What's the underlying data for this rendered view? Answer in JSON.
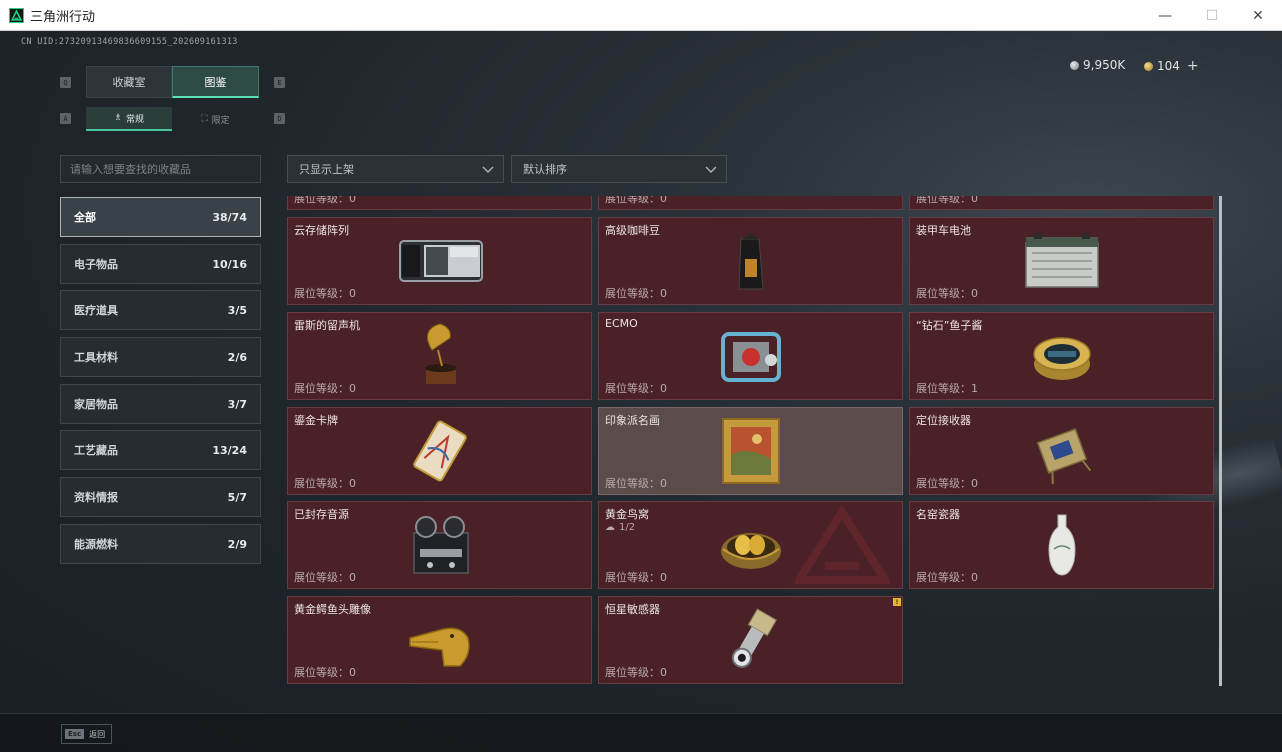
{
  "window": {
    "title": "三角洲行动",
    "minimize": "—",
    "maximize": "☐",
    "close": "✕"
  },
  "header": {
    "uid": "CN UID:2732091346983660915​5_202609161313",
    "currency_silver": "9,950K",
    "currency_gold": "104",
    "add_label": "+"
  },
  "keys": {
    "prev_tab": "Q",
    "next_tab": "E",
    "prev_sub": "A",
    "next_sub": "D"
  },
  "tabs": [
    {
      "label": "收藏室"
    },
    {
      "label": "图鉴"
    }
  ],
  "subtabs": [
    {
      "label": "常规",
      "icon": "♗"
    },
    {
      "label": "限定",
      "icon": "⛶"
    }
  ],
  "search": {
    "placeholder": "请输入想要查找的收藏品"
  },
  "filters": {
    "display": "只显示上架",
    "sort": "默认排序"
  },
  "categories": [
    {
      "label": "全部",
      "count": "38/74"
    },
    {
      "label": "电子物品",
      "count": "10/16"
    },
    {
      "label": "医疗道具",
      "count": "3/5"
    },
    {
      "label": "工具材料",
      "count": "2/6"
    },
    {
      "label": "家居物品",
      "count": "3/7"
    },
    {
      "label": "工艺藏品",
      "count": "13/24"
    },
    {
      "label": "资料情报",
      "count": "5/7"
    },
    {
      "label": "能源燃料",
      "count": "2/9"
    }
  ],
  "level_prefix": "展位等级：",
  "items": [
    {
      "name": "",
      "level": "0",
      "icon": "partial-item-icon"
    },
    {
      "name": "",
      "level": "0",
      "icon": "partial-item-icon"
    },
    {
      "name": "",
      "level": "0",
      "icon": "partial-item-icon"
    },
    {
      "name": "云存储阵列",
      "level": "0",
      "icon": "cloud-storage-array-icon"
    },
    {
      "name": "高级咖啡豆",
      "level": "0",
      "icon": "coffee-beans-icon"
    },
    {
      "name": "装甲车电池",
      "level": "0",
      "icon": "armored-battery-icon"
    },
    {
      "name": "雷斯的留声机",
      "level": "0",
      "icon": "gramophone-icon"
    },
    {
      "name": "ECMO",
      "level": "0",
      "icon": "ecmo-machine-icon"
    },
    {
      "name": "“钻石”鱼子酱",
      "level": "1",
      "icon": "caviar-tin-icon"
    },
    {
      "name": "鎏金卡牌",
      "level": "0",
      "icon": "gilded-card-icon"
    },
    {
      "name": "印象派名画",
      "level": "0",
      "icon": "impressionist-painting-icon"
    },
    {
      "name": "定位接收器",
      "level": "0",
      "icon": "locator-receiver-icon"
    },
    {
      "name": "已封存音源",
      "level": "0",
      "icon": "reel-recorder-icon"
    },
    {
      "name": "黄金鸟窝",
      "level": "0",
      "icon": "golden-nest-icon",
      "sub": "1/2"
    },
    {
      "name": "名窑瓷器",
      "level": "0",
      "icon": "porcelain-vase-icon"
    },
    {
      "name": "黄金鳄鱼头雕像",
      "level": "0",
      "icon": "gold-crocodile-icon"
    },
    {
      "name": "恒星敏感器",
      "level": "0",
      "icon": "star-sensor-icon",
      "badge": "!"
    }
  ],
  "footer": {
    "esc_key": "Esc",
    "back_label": "返回"
  },
  "colors": {
    "accent": "#5de0b3",
    "card_bg": "#4a2127",
    "card_highlight": "#5b4b4b"
  }
}
